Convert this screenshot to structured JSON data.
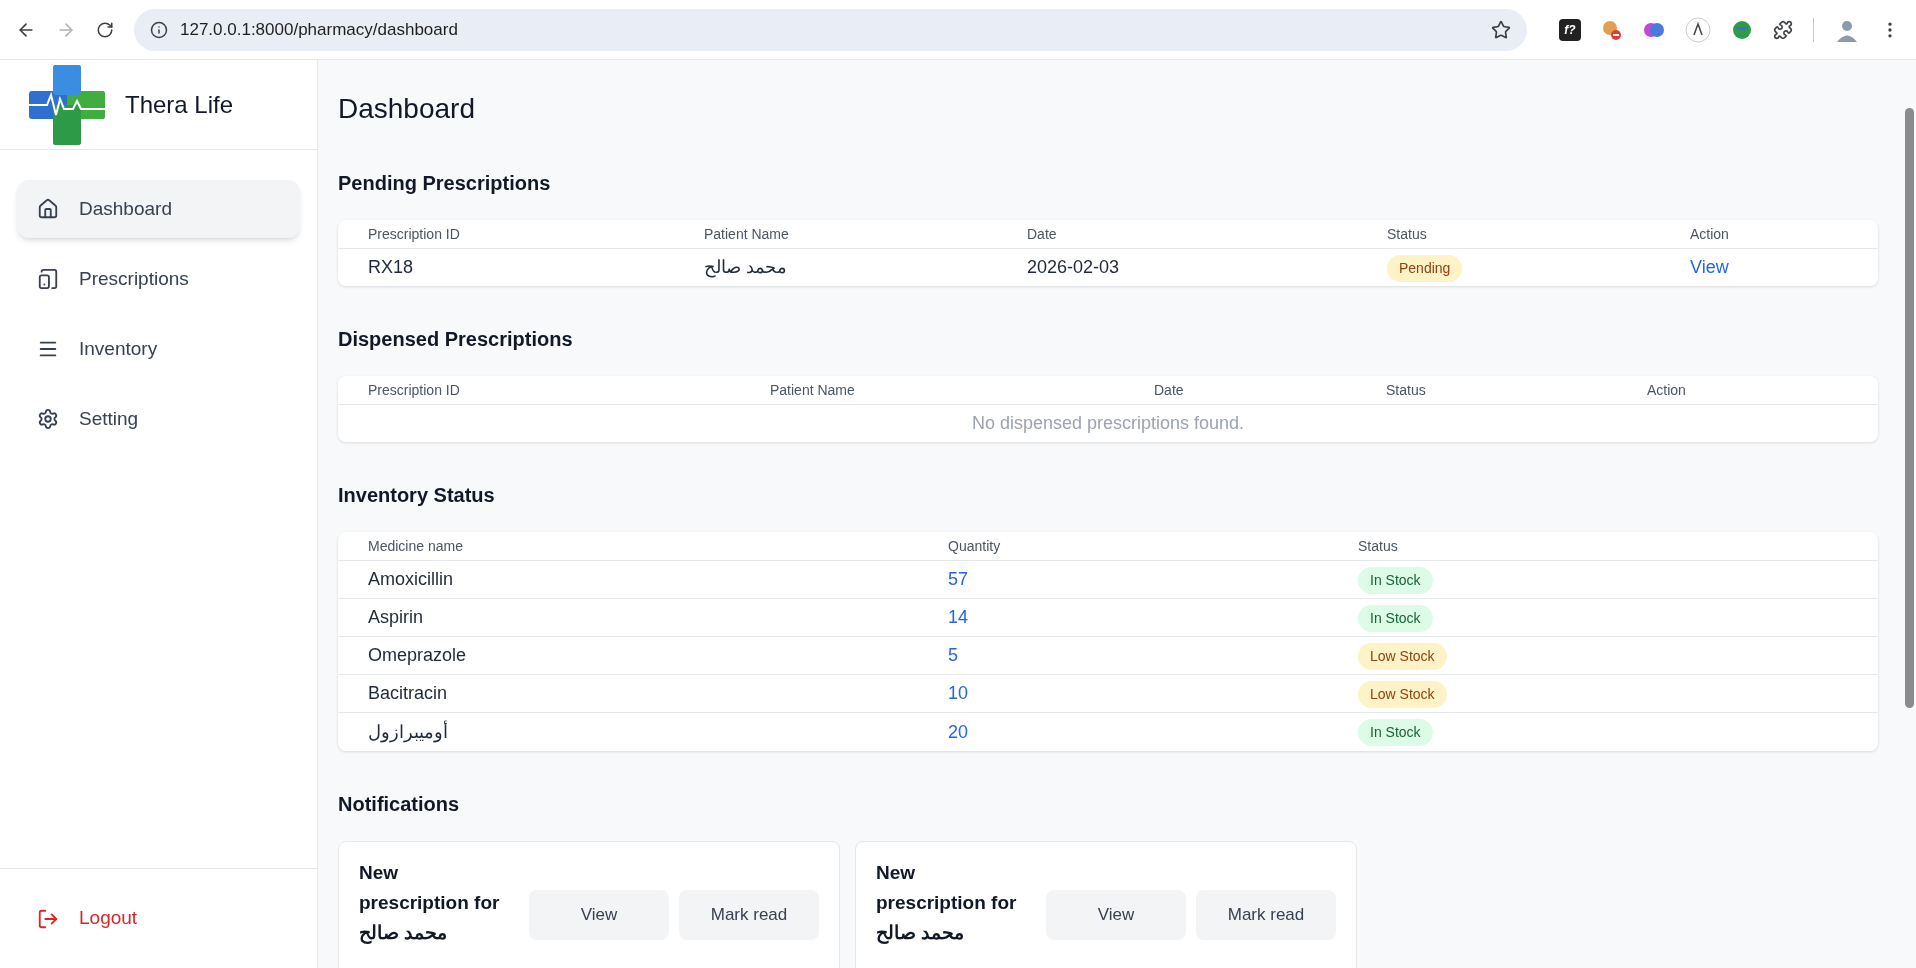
{
  "browser": {
    "url": "127.0.0.1:8000/pharmacy/dashboard",
    "forward_disabled": true,
    "extensions_badge": "f?"
  },
  "sidebar": {
    "brand": "Thera Life",
    "items": [
      {
        "label": "Dashboard",
        "selected": true
      },
      {
        "label": "Prescriptions",
        "selected": false
      },
      {
        "label": "Inventory",
        "selected": false
      },
      {
        "label": "Setting",
        "selected": false
      }
    ],
    "logout": "Logout"
  },
  "page_title": "Dashboard",
  "pending": {
    "title": "Pending Prescriptions",
    "columns": [
      "Prescription ID",
      "Patient Name",
      "Date",
      "Status",
      "Action"
    ],
    "rows": [
      {
        "id": "RX18",
        "patient": "محمد صالح",
        "date": "2026-02-03",
        "status": {
          "text": "Pending",
          "color": "#fef3c7"
        },
        "action": "View"
      }
    ]
  },
  "dispensed": {
    "title": "Dispensed Prescriptions",
    "columns": [
      "Prescription ID",
      "Patient Name",
      "Date",
      "Status",
      "Action"
    ],
    "empty": "No dispensed prescriptions found."
  },
  "inventory": {
    "title": "Inventory Status",
    "columns": [
      "Medicine name",
      "Quantity",
      "Status"
    ],
    "rows": [
      {
        "name": "Amoxicillin",
        "quantity": "57",
        "status": {
          "text": "In Stock",
          "color": "#dcfce7"
        }
      },
      {
        "name": "Aspirin",
        "quantity": "14",
        "status": {
          "text": "In Stock",
          "color": "#dcfce7"
        }
      },
      {
        "name": "Omeprazole",
        "quantity": "5",
        "status": {
          "text": "Low Stock",
          "color": "#fef3c7"
        }
      },
      {
        "name": "Bacitracin",
        "quantity": "10",
        "status": {
          "text": "Low Stock",
          "color": "#fef3c7"
        }
      },
      {
        "name": "أوميبرازول",
        "quantity": "20",
        "status": {
          "text": "In Stock",
          "color": "#dcfce7"
        }
      }
    ]
  },
  "notifications": {
    "title": "Notifications",
    "items": [
      {
        "message": "New prescription for محمد صالح",
        "buttons": [
          "View",
          "Mark read"
        ]
      },
      {
        "message": "New prescription for محمد صالح",
        "buttons": [
          "View",
          "Mark read"
        ]
      }
    ]
  }
}
